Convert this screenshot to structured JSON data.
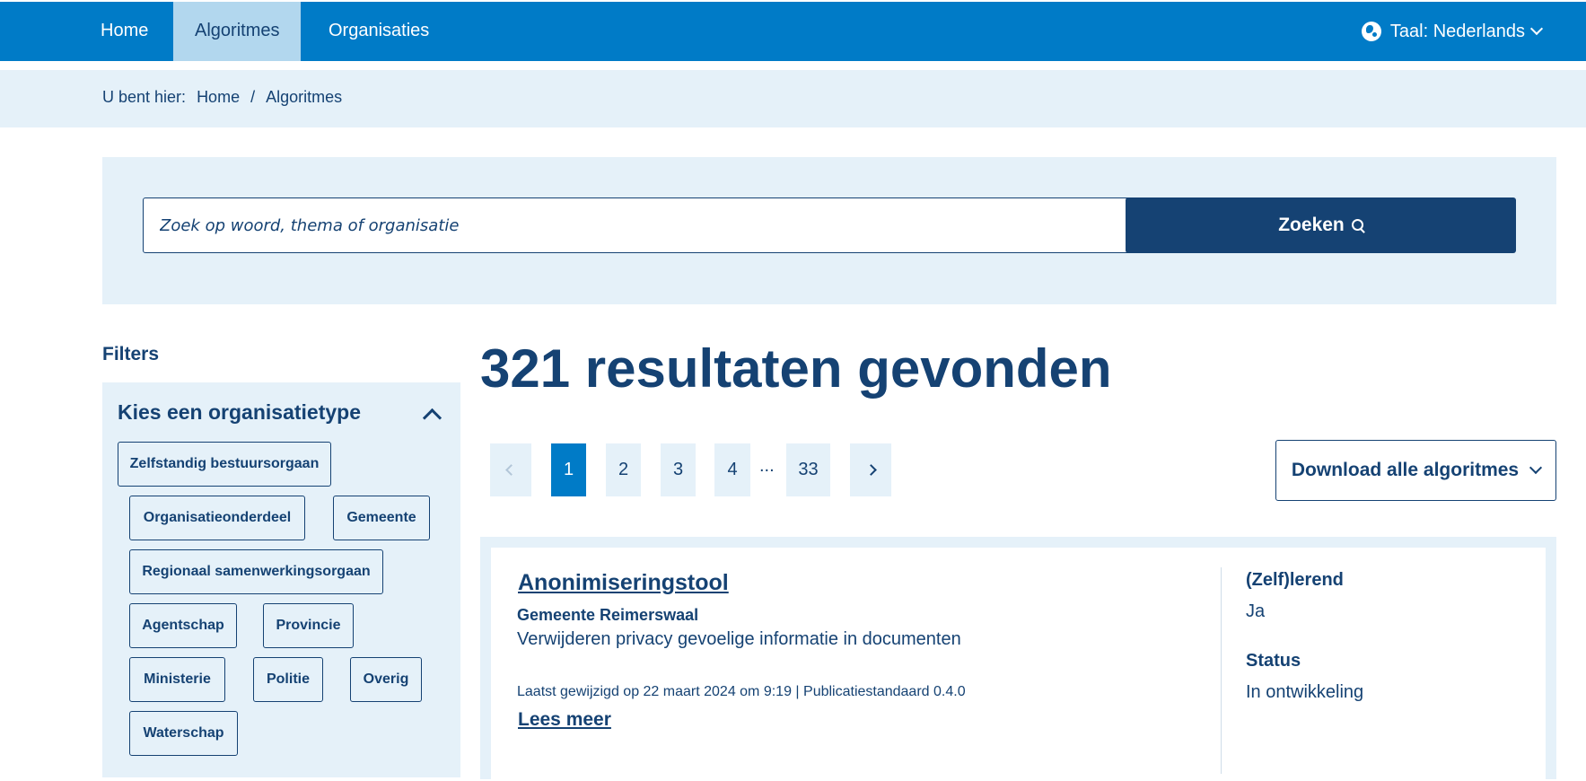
{
  "nav": {
    "tabs": [
      {
        "label": "Home"
      },
      {
        "label": "Algoritmes"
      },
      {
        "label": "Organisaties"
      }
    ],
    "language": "Taal: Nederlands"
  },
  "breadcrumb": {
    "prefix": "U bent hier:",
    "items": [
      "Home",
      "Algoritmes"
    ],
    "separator": "/"
  },
  "search": {
    "placeholder": "Zoek op woord, thema of organisatie",
    "button_label": "Zoeken"
  },
  "filters": {
    "title": "Filters",
    "group_title": "Kies een organisatietype",
    "options": [
      "Zelfstandig bestuursorgaan",
      "Organisatieonderdeel",
      "Gemeente",
      "Regionaal samenwerkingsorgaan",
      "Agentschap",
      "Provincie",
      "Ministerie",
      "Politie",
      "Overig",
      "Waterschap"
    ]
  },
  "results": {
    "heading": "321 resultaten gevonden",
    "pagination": {
      "pages": [
        "1",
        "2",
        "3",
        "4",
        "33"
      ],
      "ellipsis": "...",
      "current": "1"
    },
    "download_label": "Download alle algoritmes",
    "items": [
      {
        "title": "Anonimiseringstool",
        "organisation": "Gemeente Reimerswaal",
        "description": "Verwijderen privacy gevoelige informatie in documenten",
        "meta": "Laatst gewijzigd op 22 maart 2024 om 9:19 | Publicatiestandaard 0.4.0",
        "read_more": "Lees meer",
        "self_learning_label": "(Zelf)lerend",
        "self_learning_value": "Ja",
        "status_label": "Status",
        "status_value": "In ontwikkeling"
      }
    ]
  },
  "colors": {
    "primary_blue": "#007bc7",
    "dark_blue": "#154273",
    "light_blue": "#e5f1f9",
    "active_tab": "#b2d7ee"
  }
}
